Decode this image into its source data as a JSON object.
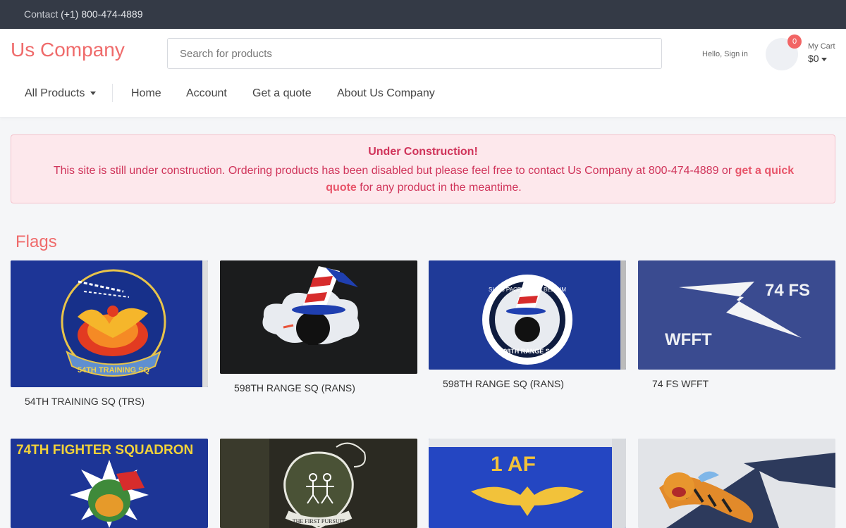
{
  "topbar": {
    "contact_label": "Contact",
    "phone": "(+1) 800-474-4889"
  },
  "header": {
    "brand": "Us Company",
    "search_placeholder": "Search for products",
    "signin": "Hello, Sign in",
    "cart": {
      "count": "0",
      "label": "My Cart",
      "total": "$0"
    }
  },
  "nav": {
    "all_products": "All Products",
    "home": "Home",
    "account": "Account",
    "quote": "Get a quote",
    "about": "About Us Company"
  },
  "alert": {
    "title": "Under Construction!",
    "body_before": "This site is still under construction. Ordering products has been disabled but please feel free to contact Us Company at 800-474-4889 or",
    "link": "get a quick quote",
    "body_after": "for any product in the meantime."
  },
  "section": {
    "title": "Flags"
  },
  "products": [
    {
      "name": "54TH TRAINING SQ (TRS)",
      "emblem_text": "54TH TRAINING SQ"
    },
    {
      "name": "598TH RANGE SQ (RANS)"
    },
    {
      "name": "598TH RANGE SQ (RANS)",
      "emblem_text": "SI VIS PACEM PARA BELLUM",
      "emblem_text2": "598TH RANGE SQ"
    },
    {
      "name": "74 FS WFFT",
      "emblem_text": "74 FS",
      "emblem_text2": "WFFT"
    },
    {
      "name": "",
      "emblem_text": "74TH FIGHTER SQUADRON"
    },
    {
      "name": "",
      "emblem_text": "THE FIRST PURSUIT"
    },
    {
      "name": "",
      "emblem_text": "1 AF"
    },
    {
      "name": ""
    }
  ],
  "colors": {
    "accent": "#ef6b6b",
    "topbar": "#343a46",
    "alert_text": "#d0345a",
    "alert_bg": "#fde8ec"
  }
}
